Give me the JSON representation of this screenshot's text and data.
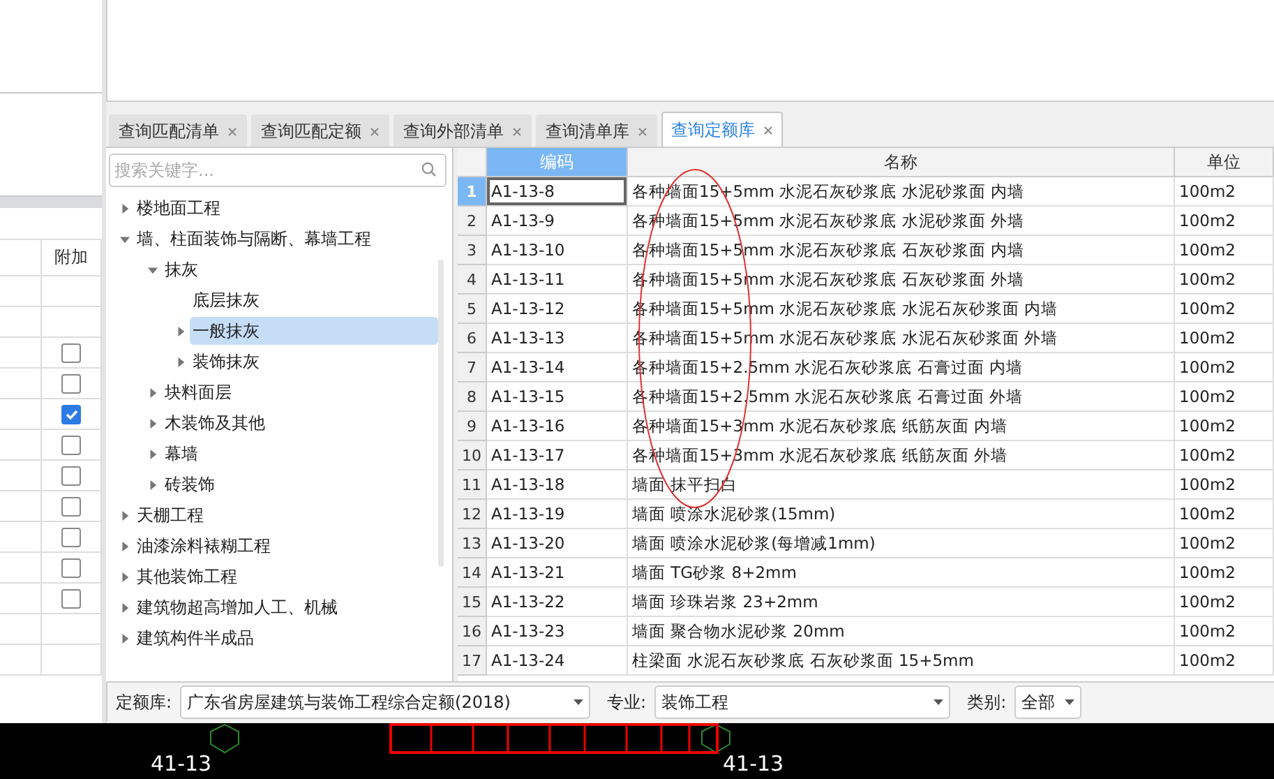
{
  "left_panel": {
    "table": {
      "columns": [
        "附加"
      ],
      "rows": [
        {
          "kind": "blank"
        },
        {
          "kind": "blank"
        },
        {
          "kind": "checkbox",
          "checked": false
        },
        {
          "kind": "checkbox",
          "checked": false
        },
        {
          "kind": "checkbox",
          "checked": true
        },
        {
          "kind": "checkbox",
          "checked": false
        },
        {
          "kind": "checkbox",
          "checked": false
        },
        {
          "kind": "checkbox",
          "checked": false
        },
        {
          "kind": "checkbox",
          "checked": false
        },
        {
          "kind": "checkbox",
          "checked": false
        },
        {
          "kind": "checkbox",
          "checked": false
        },
        {
          "kind": "blank"
        },
        {
          "kind": "blank"
        }
      ]
    }
  },
  "tabs": [
    {
      "label": "查询匹配清单",
      "selected": false
    },
    {
      "label": "查询匹配定额",
      "selected": false
    },
    {
      "label": "查询外部清单",
      "selected": false
    },
    {
      "label": "查询清单库",
      "selected": false
    },
    {
      "label": "查询定额库",
      "selected": true
    }
  ],
  "search": {
    "placeholder": "搜索关键字..."
  },
  "tree": [
    {
      "label": "楼地面工程",
      "expanded": false,
      "selected": false
    },
    {
      "label": "墙、柱面装饰与隔断、幕墙工程",
      "expanded": true,
      "selected": false,
      "children": [
        {
          "label": "抹灰",
          "expanded": true,
          "selected": false,
          "children": [
            {
              "label": "底层抹灰",
              "selected": false
            },
            {
              "label": "一般抹灰",
              "expanded": false,
              "selected": true
            },
            {
              "label": "装饰抹灰",
              "expanded": false,
              "selected": false
            }
          ]
        },
        {
          "label": "块料面层",
          "expanded": false,
          "selected": false
        },
        {
          "label": "木装饰及其他",
          "expanded": false,
          "selected": false
        },
        {
          "label": "幕墙",
          "expanded": false,
          "selected": false
        },
        {
          "label": "砖装饰",
          "expanded": false,
          "selected": false
        }
      ]
    },
    {
      "label": "天棚工程",
      "expanded": false,
      "selected": false
    },
    {
      "label": "油漆涂料裱糊工程",
      "expanded": false,
      "selected": false
    },
    {
      "label": "其他装饰工程",
      "expanded": false,
      "selected": false
    },
    {
      "label": "建筑物超高增加人工、机械",
      "expanded": false,
      "selected": false
    },
    {
      "label": "建筑构件半成品",
      "expanded": false,
      "selected": false
    }
  ],
  "table": {
    "columns": [
      {
        "label": "编码",
        "selected": true
      },
      {
        "label": "名称",
        "selected": false
      },
      {
        "label": "单位",
        "selected": false
      }
    ],
    "rows": [
      {
        "no": "1",
        "code": "A1-13-8",
        "name": "各种墙面15+5mm 水泥石灰砂浆底 水泥砂浆面 内墙",
        "unit": "100m2",
        "selected": true
      },
      {
        "no": "2",
        "code": "A1-13-9",
        "name": "各种墙面15+5mm 水泥石灰砂浆底 水泥砂浆面 外墙",
        "unit": "100m2",
        "selected": false
      },
      {
        "no": "3",
        "code": "A1-13-10",
        "name": "各种墙面15+5mm 水泥石灰砂浆底 石灰砂浆面 内墙",
        "unit": "100m2",
        "selected": false
      },
      {
        "no": "4",
        "code": "A1-13-11",
        "name": "各种墙面15+5mm 水泥石灰砂浆底 石灰砂浆面 外墙",
        "unit": "100m2",
        "selected": false
      },
      {
        "no": "5",
        "code": "A1-13-12",
        "name": "各种墙面15+5mm 水泥石灰砂浆底 水泥石灰砂浆面 内墙",
        "unit": "100m2",
        "selected": false
      },
      {
        "no": "6",
        "code": "A1-13-13",
        "name": "各种墙面15+5mm 水泥石灰砂浆底 水泥石灰砂浆面 外墙",
        "unit": "100m2",
        "selected": false
      },
      {
        "no": "7",
        "code": "A1-13-14",
        "name": "各种墙面15+2.5mm 水泥石灰砂浆底 石膏过面 内墙",
        "unit": "100m2",
        "selected": false
      },
      {
        "no": "8",
        "code": "A1-13-15",
        "name": "各种墙面15+2.5mm 水泥石灰砂浆底 石膏过面 外墙",
        "unit": "100m2",
        "selected": false
      },
      {
        "no": "9",
        "code": "A1-13-16",
        "name": "各种墙面15+3mm 水泥石灰砂浆底 纸筋灰面 内墙",
        "unit": "100m2",
        "selected": false
      },
      {
        "no": "10",
        "code": "A1-13-17",
        "name": "各种墙面15+3mm 水泥石灰砂浆底 纸筋灰面 外墙",
        "unit": "100m2",
        "selected": false
      },
      {
        "no": "11",
        "code": "A1-13-18",
        "name": "墙面 抹平扫白",
        "unit": "100m2",
        "selected": false
      },
      {
        "no": "12",
        "code": "A1-13-19",
        "name": "墙面 喷涂水泥砂浆(15mm)",
        "unit": "100m2",
        "selected": false
      },
      {
        "no": "13",
        "code": "A1-13-20",
        "name": "墙面 喷涂水泥砂浆(每增减1mm)",
        "unit": "100m2",
        "selected": false
      },
      {
        "no": "14",
        "code": "A1-13-21",
        "name": "墙面 TG砂浆 8+2mm",
        "unit": "100m2",
        "selected": false
      },
      {
        "no": "15",
        "code": "A1-13-22",
        "name": "墙面 珍珠岩浆 23+2mm",
        "unit": "100m2",
        "selected": false
      },
      {
        "no": "16",
        "code": "A1-13-23",
        "name": "墙面 聚合物水泥砂浆 20mm",
        "unit": "100m2",
        "selected": false
      },
      {
        "no": "17",
        "code": "A1-13-24",
        "name": "柱梁面 水泥石灰砂浆底 石灰砂浆面 15+5mm",
        "unit": "100m2",
        "selected": false
      }
    ]
  },
  "filters": [
    {
      "label": "定额库:",
      "value": "广东省房屋建筑与装饰工程综合定额(2018)"
    },
    {
      "label": "专业:",
      "value": "装饰工程"
    },
    {
      "label": "类别:",
      "value": "全部"
    }
  ],
  "cad": {
    "labels": [
      "41-13",
      "41-13"
    ]
  }
}
